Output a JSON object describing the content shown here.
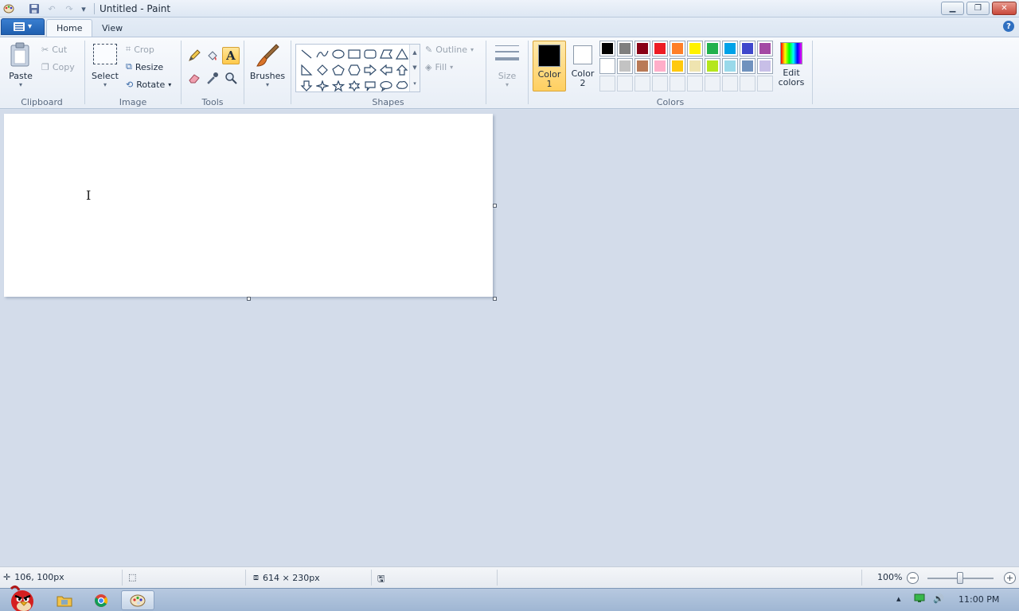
{
  "window": {
    "title": "Untitled - Paint",
    "controls": {
      "minimize": "▁",
      "restore": "❐",
      "close": "✕"
    }
  },
  "quick_access": {
    "customize": "▾"
  },
  "tabs": [
    {
      "label": "Home",
      "active": true
    },
    {
      "label": "View",
      "active": false
    }
  ],
  "help_label": "?",
  "ribbon": {
    "clipboard": {
      "group": "Clipboard",
      "paste": "Paste",
      "cut": "Cut",
      "copy": "Copy"
    },
    "image": {
      "group": "Image",
      "select": "Select",
      "crop": "Crop",
      "resize": "Resize",
      "rotate": "Rotate"
    },
    "tools": {
      "group": "Tools"
    },
    "brushes": {
      "label": "Brushes"
    },
    "shapes": {
      "group": "Shapes",
      "outline": "Outline",
      "fill": "Fill"
    },
    "size": {
      "label": "Size"
    },
    "colors": {
      "group": "Colors",
      "color1_line1": "Color",
      "color1_line2": "1",
      "color2_line1": "Color",
      "color2_line2": "2",
      "edit_line1": "Edit",
      "edit_line2": "colors",
      "color1_value": "#000000",
      "color2_value": "#ffffff",
      "palette_row1": [
        "#000000",
        "#7f7f7f",
        "#880015",
        "#ed1c24",
        "#ff7f27",
        "#fff200",
        "#22b14c",
        "#00a2e8",
        "#3f48cc",
        "#a349a4"
      ],
      "palette_row2": [
        "#ffffff",
        "#c3c3c3",
        "#b97a57",
        "#ffaec9",
        "#ffc90e",
        "#efe4b0",
        "#b5e61d",
        "#99d9ea",
        "#7092be",
        "#c8bfe7"
      ]
    }
  },
  "status": {
    "cursor_pos": "106, 100px",
    "image_size": "614 × 230px",
    "zoom": "100%"
  },
  "taskbar": {
    "clock": "11:00 PM"
  }
}
